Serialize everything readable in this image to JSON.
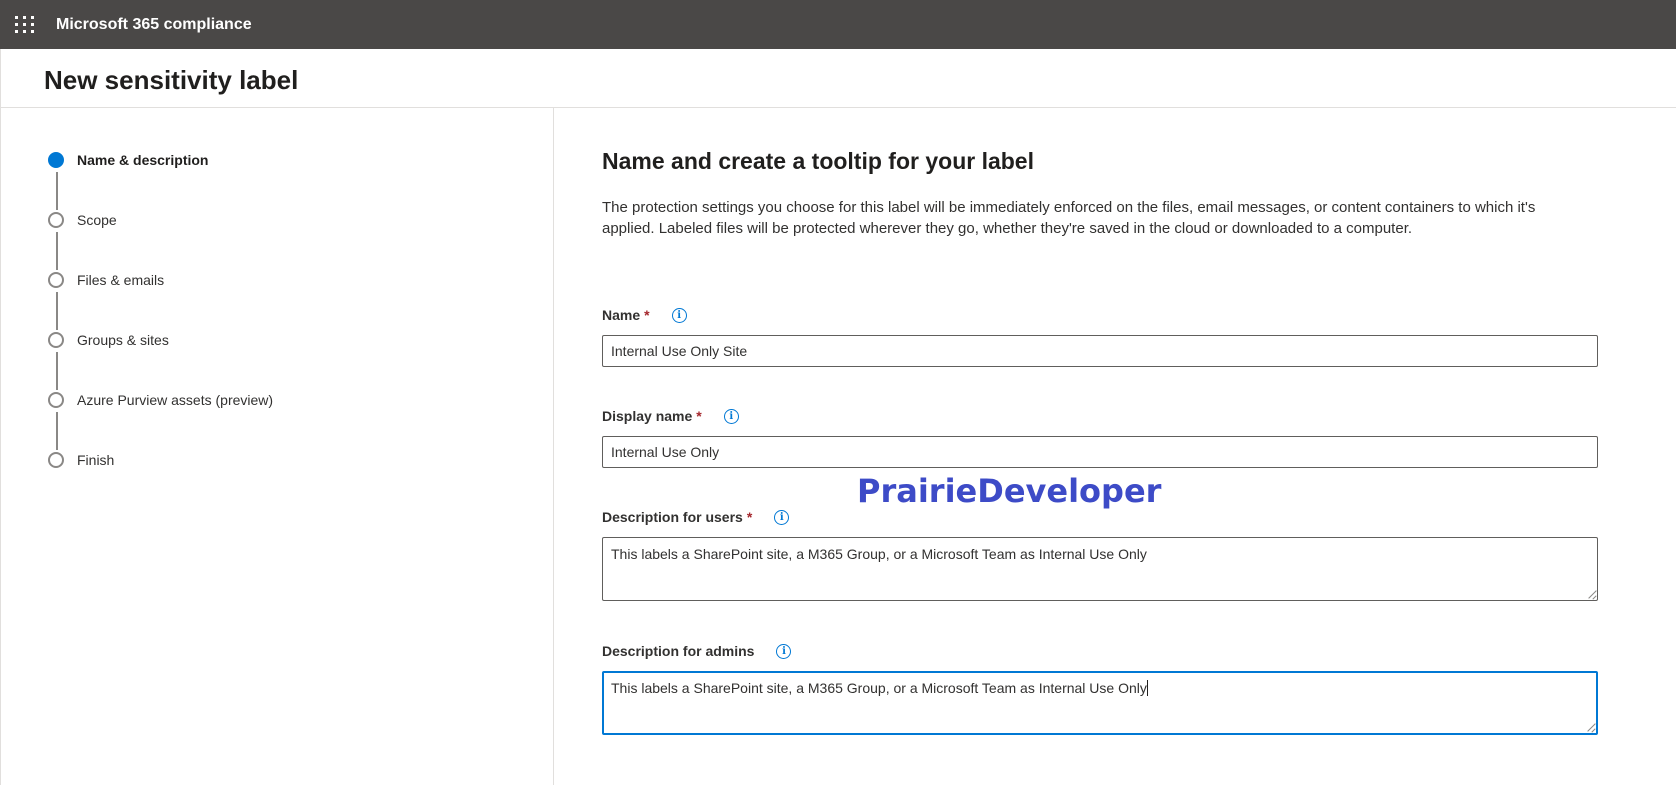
{
  "header": {
    "app_title": "Microsoft 365 compliance",
    "waffle_icon": "app-launcher-icon"
  },
  "page": {
    "title": "New sensitivity label"
  },
  "wizard": {
    "steps": [
      {
        "label": "Name & description",
        "state": "current"
      },
      {
        "label": "Scope",
        "state": "upcoming"
      },
      {
        "label": "Files & emails",
        "state": "upcoming"
      },
      {
        "label": "Groups & sites",
        "state": "upcoming"
      },
      {
        "label": "Azure Purview assets (preview)",
        "state": "upcoming"
      },
      {
        "label": "Finish",
        "state": "upcoming"
      }
    ]
  },
  "form": {
    "heading": "Name and create a tooltip for your label",
    "intro": "The protection settings you choose for this label will be immediately enforced on the files, email messages, or content containers to which it's applied. Labeled files will be protected wherever they go, whether they're saved in the cloud or downloaded to a computer.",
    "name": {
      "label": "Name",
      "required_mark": "*",
      "value": "Internal Use Only Site"
    },
    "display_name": {
      "label": "Display name",
      "required_mark": "*",
      "value": "Internal Use Only"
    },
    "description_users": {
      "label": "Description for users",
      "required_mark": "*",
      "value": "This labels a SharePoint site, a M365 Group, or a Microsoft Team as Internal Use Only"
    },
    "description_admins": {
      "label": "Description for admins",
      "value": "This labels a SharePoint site, a M365 Group, or a Microsoft Team as Internal Use Only"
    },
    "info_glyph": "i"
  },
  "watermark": {
    "text": "PrairieDeveloper"
  },
  "colors": {
    "topbar": "#4a4847",
    "accent": "#0078d4",
    "required": "#a4262c",
    "watermark": "#3d4bc7"
  }
}
